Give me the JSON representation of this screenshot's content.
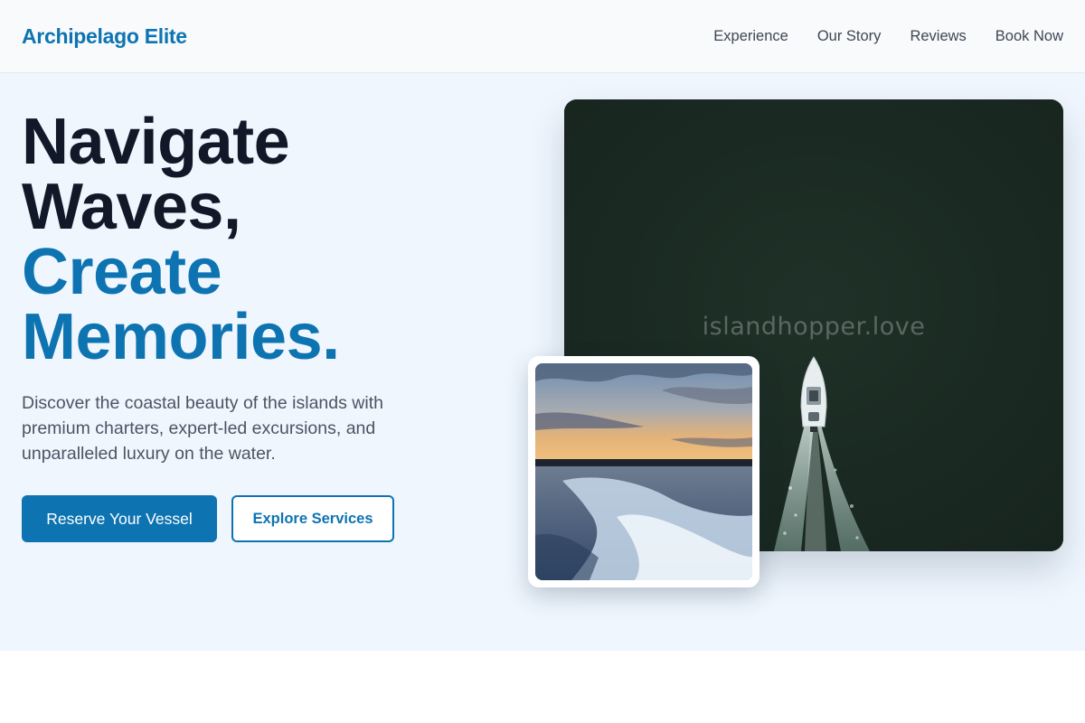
{
  "nav": {
    "brand": "Archipelago Elite",
    "links": [
      "Experience",
      "Our Story",
      "Reviews",
      "Book Now"
    ]
  },
  "hero": {
    "title_line1": "Navigate",
    "title_line2": "Waves,",
    "title_accent1": "Create",
    "title_accent2": "Memories.",
    "description": "Discover the coastal beauty of the islands with premium charters, expert-led excursions, and unparalleled luxury on the water.",
    "primary_button": "Reserve Your Vessel",
    "secondary_button": "Explore Services"
  },
  "media": {
    "watermark": "islandhopper.love"
  },
  "colors": {
    "brand": "#0e74b1",
    "heading": "#111827",
    "hero_bg": "#eff6fe",
    "body_text": "#4b5563"
  }
}
